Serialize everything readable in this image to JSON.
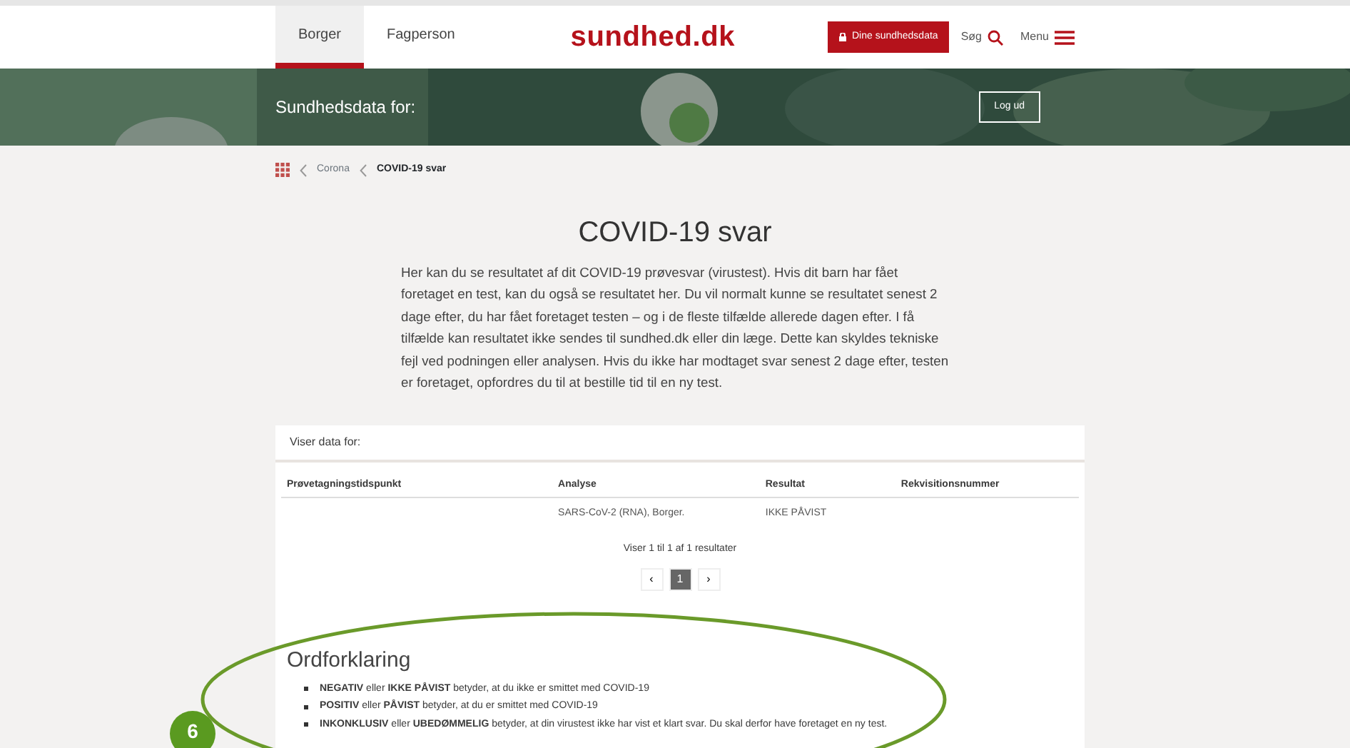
{
  "header": {
    "tabs": [
      {
        "label": "Borger",
        "selected": true
      },
      {
        "label": "Fagperson",
        "selected": false
      }
    ],
    "logo": {
      "name": "sundhed",
      "tld": ".dk"
    },
    "data_button": "Dine sundhedsdata",
    "search": "Søg",
    "menu": "Menu"
  },
  "banner": {
    "title": "Sundhedsdata for:",
    "logout": "Log ud"
  },
  "breadcrumb": [
    "Corona",
    "COVID-19 svar"
  ],
  "title": "COVID-19 svar",
  "intro": "Her kan du se resultatet af dit COVID-19 prøvesvar (virustest). Hvis dit barn har fået foretaget en test, kan du også se resultatet her. Du vil normalt kunne se resultatet senest 2 dage efter, du har fået foretaget testen – og i de fleste tilfælde allerede dagen efter. I få tilfælde kan resultatet ikke sendes til sundhed.dk eller din læge. Dette kan skyldes tekniske fejl ved podningen eller analysen. Hvis du ikke har modtaget svar senest 2 dage efter, testen er foretaget, opfordres du til at bestille tid til en ny test.",
  "results": {
    "viewing_for": "Viser data for:",
    "columns": [
      "Prøvetagningstidspunkt",
      "Analyse",
      "Resultat",
      "Rekvisitionsnummer"
    ],
    "rows": [
      [
        "",
        "SARS-CoV-2 (RNA), Borger.",
        "IKKE PÅVIST",
        ""
      ]
    ],
    "summary": "Viser 1 til 1 af 1 resultater",
    "pages": [
      {
        "label": "‹",
        "selected": false
      },
      {
        "label": "1",
        "selected": true
      },
      {
        "label": "›",
        "selected": false
      }
    ]
  },
  "glossary": {
    "title": "Ordforklaring",
    "items": [
      "**NEGATIV** eller **IKKE PÅVIST** betyder, at du ikke er smittet med COVID-19",
      "**POSITIV** eller **PÅVIST** betyder, at du er smittet med COVID-19",
      "**INKONKLUSIV** eller **UBEDØMMELIG** betyder, at din virustest ikke har vist et klart svar. Du skal derfor have foretaget en ny test."
    ]
  },
  "annotation": {
    "number": "6"
  }
}
